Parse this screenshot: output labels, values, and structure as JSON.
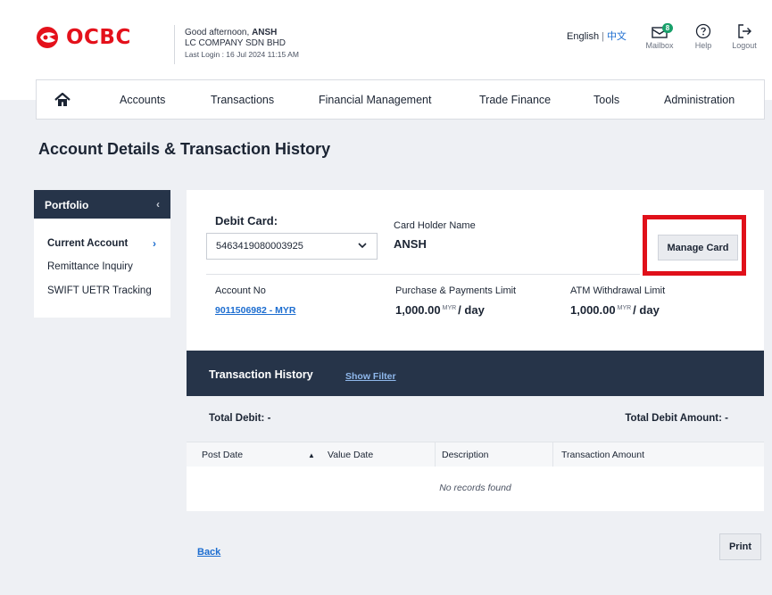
{
  "header": {
    "brand": "OCBC",
    "greeting_prefix": "Good afternoon, ",
    "user": "ANSH",
    "company": "LC COMPANY SDN BHD",
    "last_login": "Last Login : 16 Jul 2024 11:15 AM",
    "lang_en": "English",
    "lang_sep": "|",
    "lang_zh": "中文",
    "mailbox_label": "Mailbox",
    "mailbox_count": "8",
    "help_label": "Help",
    "logout_label": "Logout"
  },
  "nav": {
    "home_icon": "home-icon",
    "items": [
      "Accounts",
      "Transactions",
      "Financial Management",
      "Trade Finance",
      "Tools",
      "Administration"
    ]
  },
  "page_title": "Account Details & Transaction History",
  "sidebar": {
    "title": "Portfolio",
    "items": [
      "Current Account",
      "Remittance Inquiry",
      "SWIFT UETR Tracking"
    ]
  },
  "card": {
    "debit_label": "Debit Card:",
    "card_number": "5463419080003925",
    "holder_label": "Card Holder Name",
    "holder_name": "ANSH",
    "manage_label": "Manage Card",
    "account_label": "Account No",
    "account_value": "9011506982 - MYR",
    "purchase_label": "Purchase & Payments Limit",
    "purchase_amount": "1,000.00",
    "purchase_ccy": "MYR",
    "purchase_period": "/ day",
    "atm_label": "ATM Withdrawal Limit",
    "atm_amount": "1,000.00",
    "atm_ccy": "MYR",
    "atm_period": "/ day"
  },
  "transactions": {
    "title": "Transaction History",
    "show_filter": "Show Filter",
    "total_debit": "Total Debit: -",
    "total_debit_amount": "Total Debit Amount: -",
    "columns": [
      "Post Date",
      "Value Date",
      "Description",
      "Transaction Amount"
    ],
    "sort_indicator": "▲",
    "empty_text": "No records found"
  },
  "footer": {
    "back_label": "Back",
    "print_label": "Print"
  },
  "colors": {
    "brand_red": "#e4111b",
    "navy": "#263449",
    "link_blue": "#1c6dd0",
    "highlight_red": "#e0101a"
  }
}
